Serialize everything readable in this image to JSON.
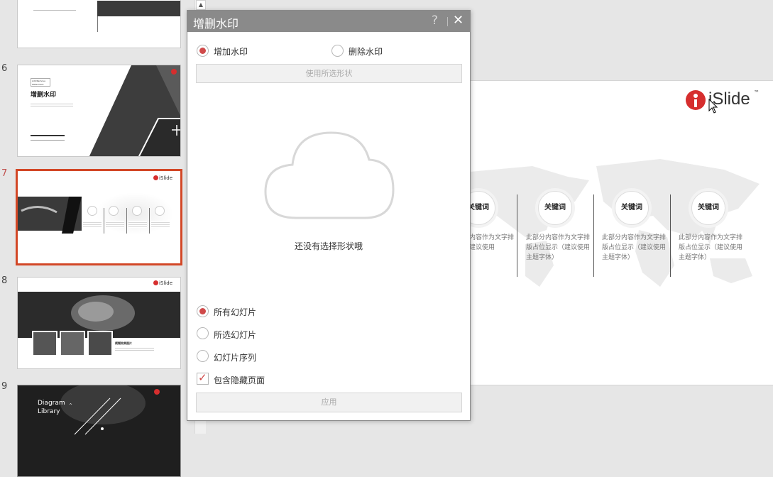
{
  "thumbnails": {
    "items": [
      {
        "number": "6",
        "title": "增删水印",
        "subtitle": "Add/Remove Watermark"
      },
      {
        "number": "7",
        "logo_text": "iSlide"
      },
      {
        "number": "8",
        "logo_text": "iSlide",
        "caption": "模糊效果图片"
      },
      {
        "number": "9",
        "title_line1": "Diagram",
        "title_line2": "Library"
      }
    ]
  },
  "dialog": {
    "title": "增删水印",
    "help_label": "?",
    "close_label": "✕",
    "add_label": "增加水印",
    "remove_label": "删除水印",
    "use_shape_label": "使用所选形状",
    "empty_text": "还没有选择形状哦",
    "scope_all": "所有幻灯片",
    "scope_selected": "所选幻灯片",
    "scope_sequence": "幻灯片序列",
    "include_hidden": "包含隐藏页面",
    "apply_label": "应用"
  },
  "slide": {
    "logo_text": "iSlide",
    "logo_tm": "™",
    "keywords": [
      {
        "label": "关键词",
        "line1": "此部分内容作为文字排",
        "line2": "显示（建议使用",
        "line3": ""
      },
      {
        "label": "关键词",
        "line1": "此部分内容作为文字排",
        "line2": "版占位显示（建议使用",
        "line3": "主题字体）"
      },
      {
        "label": "关键词",
        "line1": "此部分内容作为文字排",
        "line2": "版占位显示（建议使用",
        "line3": "主题字体）"
      },
      {
        "label": "关键词",
        "line1": "此部分内容作为文字排",
        "line2": "版占位显示（建议使用",
        "line3": "主题字体）"
      }
    ]
  },
  "colors": {
    "accent": "#d04a4a",
    "selection": "#d24726",
    "titlebar": "#8a8a8a"
  }
}
